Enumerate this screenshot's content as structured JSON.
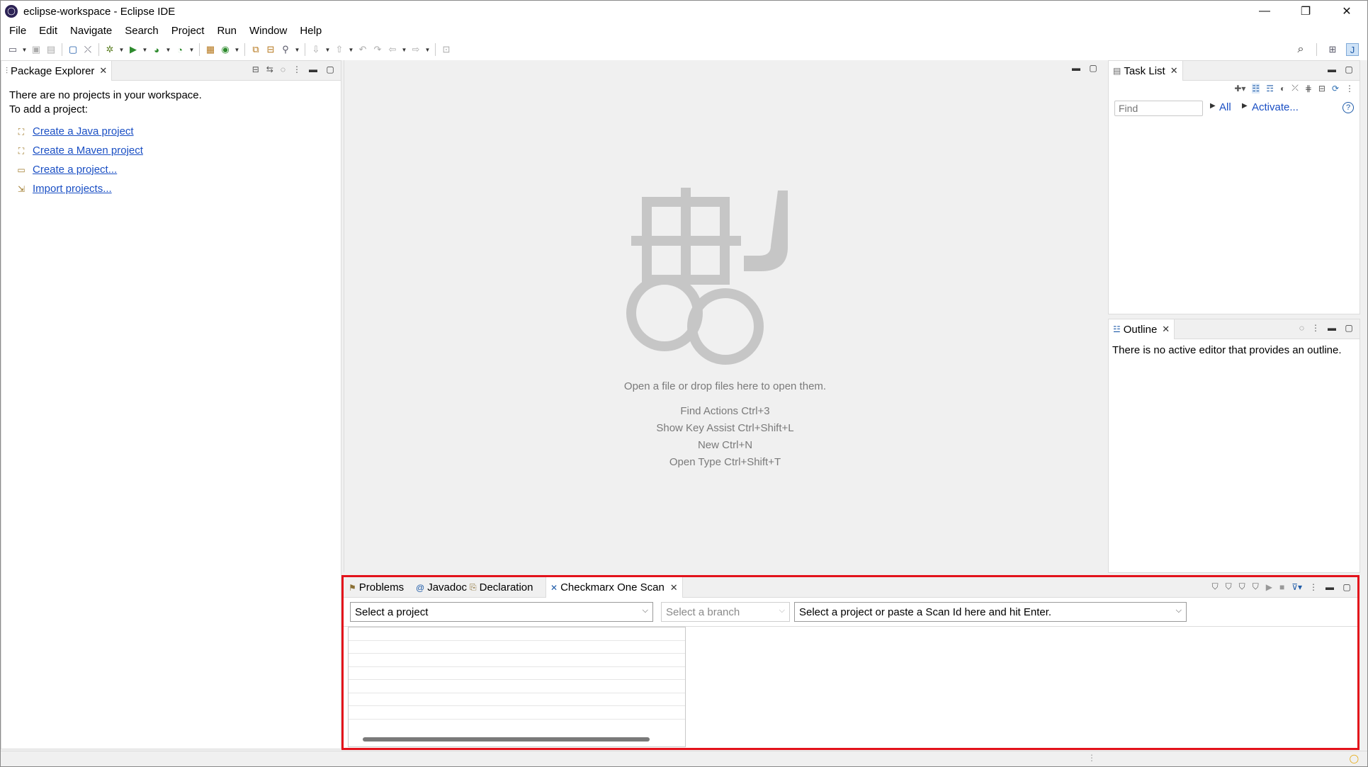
{
  "window": {
    "title": "eclipse-workspace - Eclipse IDE",
    "controls": {
      "minimize": "—",
      "restore": "❐",
      "close": "✕"
    }
  },
  "menu": [
    "File",
    "Edit",
    "Navigate",
    "Search",
    "Project",
    "Run",
    "Window",
    "Help"
  ],
  "package_explorer": {
    "tab_label": "Package Explorer",
    "empty_line1": "There are no projects in your workspace.",
    "empty_line2": "To add a project:",
    "links": [
      "Create a Java project",
      "Create a Maven project",
      "Create a project...",
      "Import projects..."
    ]
  },
  "editor": {
    "drop_hint": "Open a file or drop files here to open them.",
    "shortcuts": [
      "Find Actions Ctrl+3",
      "Show Key Assist Ctrl+Shift+L",
      "New Ctrl+N",
      "Open Type Ctrl+Shift+T"
    ]
  },
  "task_list": {
    "tab_label": "Task List",
    "find_placeholder": "Find",
    "all_label": "All",
    "activate_label": "Activate..."
  },
  "outline": {
    "tab_label": "Outline",
    "message": "There is no active editor that provides an outline."
  },
  "bottom_panel": {
    "tabs": [
      "Problems",
      "Javadoc",
      "Declaration"
    ],
    "active_tab": "Checkmarx One Scan",
    "project_combo": "Select a project",
    "branch_combo": "Select a branch",
    "scan_combo": "Select a project or paste a Scan Id here and hit Enter."
  },
  "colors": {
    "highlight_border": "#e3121b",
    "link": "#1a4fc4"
  }
}
